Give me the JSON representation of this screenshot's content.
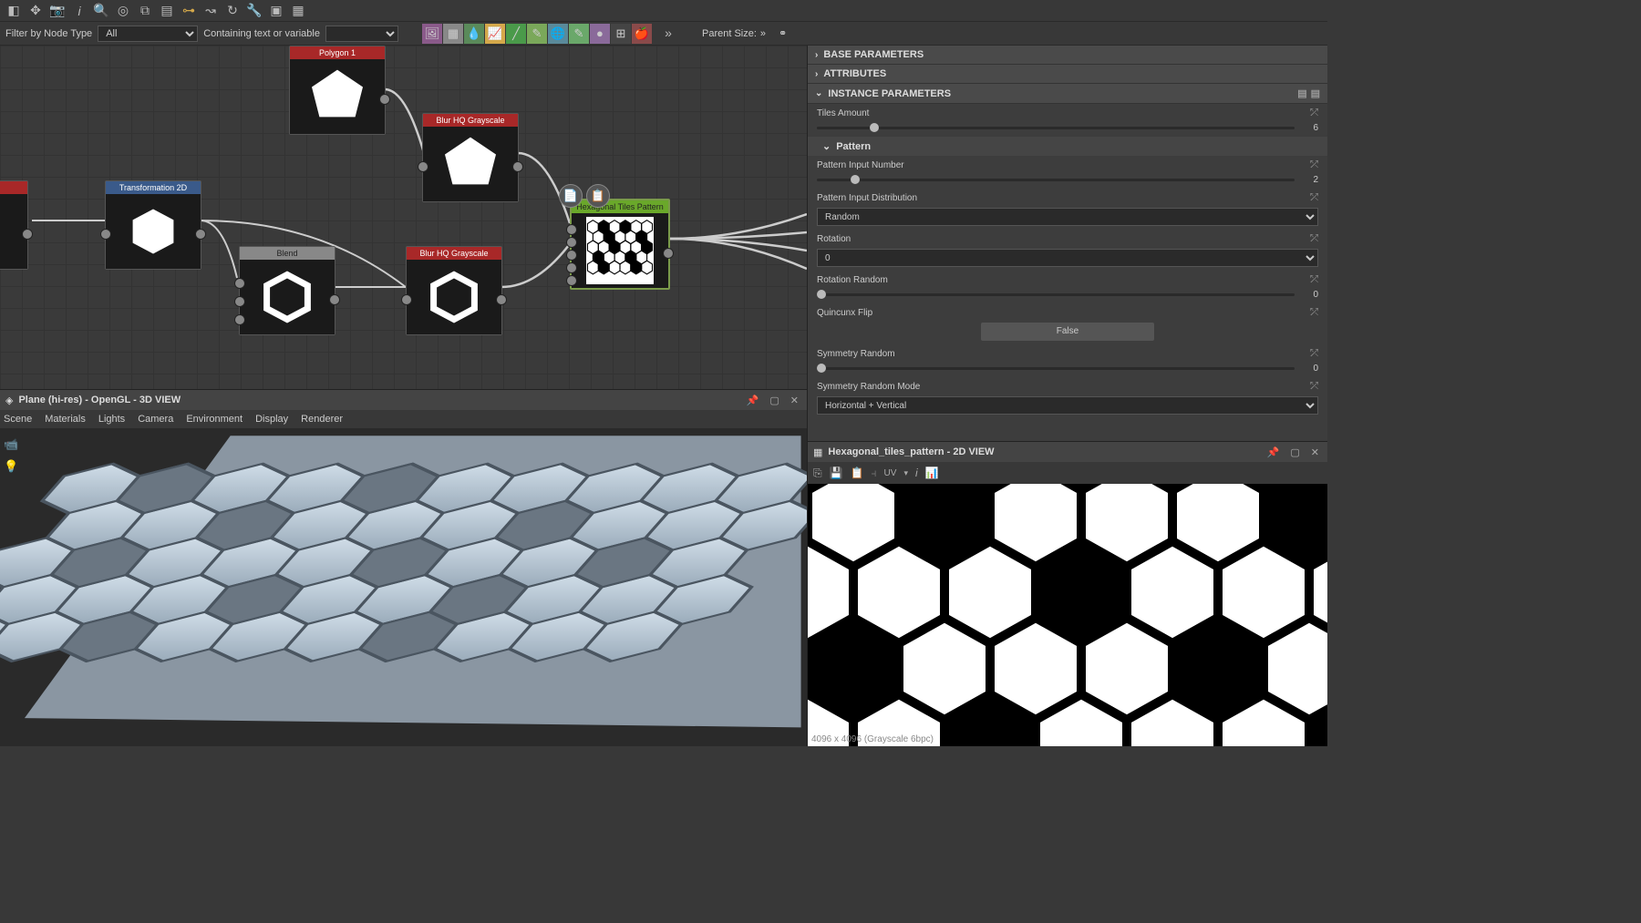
{
  "toolbar": {
    "filter_label": "Filter by Node Type",
    "filter_type_value": "All",
    "containing_label": "Containing text or variable",
    "containing_value": "",
    "parent_size_label": "Parent Size:"
  },
  "graph": {
    "nodes": {
      "polygon": "Polygon 1",
      "transform": "Transformation 2D",
      "blend": "Blend",
      "blur1": "Blur HQ Grayscale",
      "blur2": "Blur HQ Grayscale",
      "hextiles": "Hexagonal Tiles Pattern"
    }
  },
  "view3d": {
    "title": "Plane (hi-res) - OpenGL - 3D VIEW",
    "menu": [
      "Scene",
      "Materials",
      "Lights",
      "Camera",
      "Environment",
      "Display",
      "Renderer"
    ]
  },
  "props": {
    "sections": {
      "base": "BASE PARAMETERS",
      "attrs": "ATTRIBUTES",
      "instance": "INSTANCE PARAMETERS"
    },
    "tiles_amount": {
      "label": "Tiles Amount",
      "value": "6"
    },
    "pattern_header": "Pattern",
    "pattern_input_number": {
      "label": "Pattern Input Number",
      "value": "2"
    },
    "pattern_dist": {
      "label": "Pattern Input Distribution",
      "value": "Random"
    },
    "rotation": {
      "label": "Rotation",
      "value": "0"
    },
    "rotation_random": {
      "label": "Rotation Random",
      "value": "0"
    },
    "quincunx": {
      "label": "Quincunx Flip",
      "value": "False"
    },
    "symmetry_random": {
      "label": "Symmetry Random",
      "value": "0"
    },
    "symmetry_mode": {
      "label": "Symmetry Random Mode",
      "value": "Horizontal + Vertical"
    }
  },
  "view2d": {
    "title": "Hexagonal_tiles_pattern - 2D VIEW",
    "uv_label": "UV",
    "status": "4096 x 4096 (Grayscale   6bpc)"
  }
}
